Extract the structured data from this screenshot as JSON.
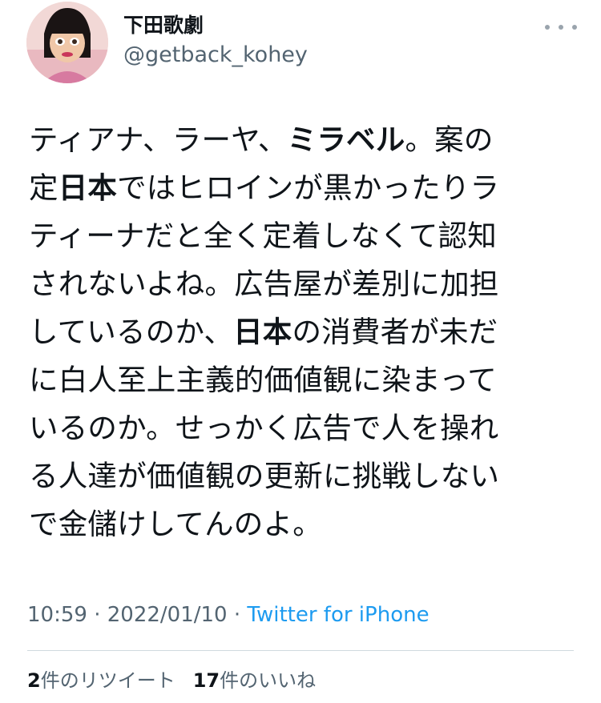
{
  "user": {
    "display_name": "下田歌劇",
    "handle": "@getback_kohey"
  },
  "tweet": {
    "lines": [
      [
        {
          "t": "ティアナ、ラーヤ、",
          "b": false
        },
        {
          "t": "ミラベル",
          "b": true
        },
        {
          "t": "。案の",
          "b": false
        }
      ],
      [
        {
          "t": "定",
          "b": false
        },
        {
          "t": "日本",
          "b": true
        },
        {
          "t": "ではヒロインが黒かったりラ",
          "b": false
        }
      ],
      [
        {
          "t": "ティーナだと全く定着しなくて認知",
          "b": false
        }
      ],
      [
        {
          "t": "されないよね。広告屋が差別に加担",
          "b": false
        }
      ],
      [
        {
          "t": "しているのか、",
          "b": false
        },
        {
          "t": "日本",
          "b": true
        },
        {
          "t": "の消費者が未だ",
          "b": false
        }
      ],
      [
        {
          "t": "に白人至上主義的価値観に染まって",
          "b": false
        }
      ],
      [
        {
          "t": "いるのか。せっかく広告で人を操れ",
          "b": false
        }
      ],
      [
        {
          "t": "る人達が価値観の更新に挑戦しない",
          "b": false
        }
      ],
      [
        {
          "t": "で金儲けしてんのよ。",
          "b": false
        }
      ]
    ]
  },
  "meta": {
    "time": "10:59",
    "separator": "·",
    "date": "2022/01/10",
    "source": "Twitter for iPhone"
  },
  "stats": {
    "retweet_count": "2",
    "retweet_label": "件のリツイート",
    "like_count": "17",
    "like_label": "件のいいね"
  },
  "colors": {
    "text": "#0f1419",
    "secondary": "#536471",
    "link": "#1d9bf0"
  },
  "icons": {
    "more": "more-horizontal-icon"
  }
}
